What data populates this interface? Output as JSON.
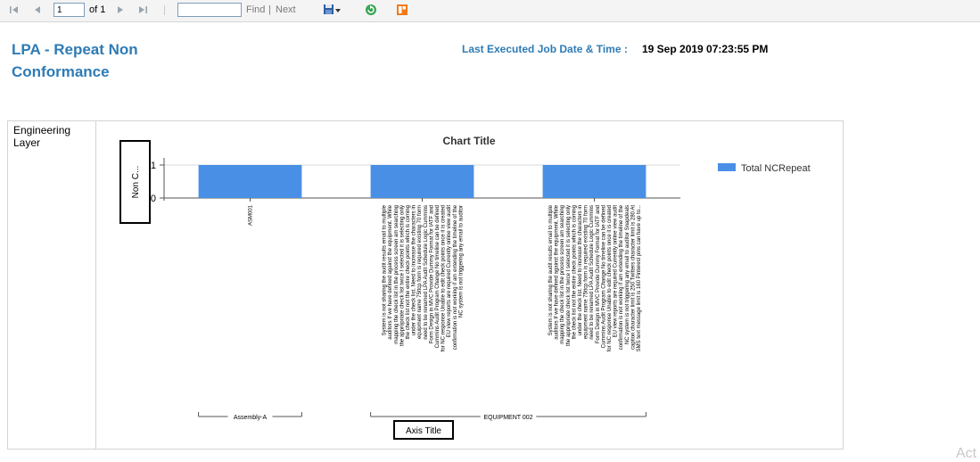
{
  "toolbar": {
    "page_value": "1",
    "page_of": "of 1",
    "search_value": "",
    "find_label": "Find",
    "separator": "|",
    "next_label": "Next"
  },
  "report": {
    "title": "LPA - Repeat Non Conformance",
    "executed_label": "Last Executed Job Date & Time :",
    "executed_value": "19 Sep 2019 07:23:55 PM"
  },
  "row": {
    "header": "Engineering Layer"
  },
  "colors": {
    "bar": "#4a8fe6",
    "title_blue": "#2e7bb5"
  },
  "chart_data": {
    "type": "bar",
    "title": "Chart Title",
    "ylabel": "Non C...",
    "xlabel": "Axis Title",
    "ylim": [
      0,
      1
    ],
    "yticks": [
      "0",
      "1"
    ],
    "categories": [
      "ASM001",
      "System is not sharing the audit results email to multiple auditors If we have defined against the equipment. While mapping the check list in the process screen am searching the appropriate check list twice I selected it is selecting only the check list not the entire check points which is coming under the check list. Need to increase the characters in equipment name 75ttcp form is required existing 70 form need to be renamed LPA Audit Schedule Logic Cummins Form Design in MVC Provide Dummy Format for IATF and Cummins Audit Program Change No timeline can be defined for NC response Unable to edit check points once it is created EU view reports are required Currently online view audit confirmation is not working if am extending the timeline of the NC system is not triggering any email to auditor",
      "System is not sharing the audit results email to multiple auditors If we have defined against the equipment. While mapping the check list in the process screen am searching the appropriate check list twice I selected it is selecting only the check list not the entire check points which is coming under the check list. Need to increase the characters in equipment name 75ttcp form is required existing 70 form need to be renamed LPA Audit Schedule Logic Cummins Form Design in MVC Provide Dummy Format for IATF and Cummins Audit Program Change No timeline can be defined for NC response Unable to edit check points once it is created EU view reports are required Currently online view audit confirmation is not working if am extending the timeline of the NC system is not triggering any email to auditor Snapdeals caption character limit is 250 Twitters character limit is 280 At SMS text message limit is 160 Pinterest pins can have up to..."
    ],
    "category_labels": [
      "ASM001",
      "System is not sharing the audit results email to multiple\nauditors If we have defined against the equipment. While\nmapping the check list in the process screen am searching\nthe appropriate check list twice I selected it is selecting only\nthe check list not the entire check points which is coming\nunder the check list. Need to increase the characters in\nequipment name 75ttcp form is required existing 70 form\nneed to be renamed LPA Audit Schedule Logic Cummins\nForm Design in MVC Provide Dummy Format for IATF and\nCummins Audit Program Change No timeline can be defined\nfor NC response Unable to edit check points once it is created\nEU view reports are required Currently online view audit\nconfirmation is not working if am extending the timeline of the\nNC system is not triggering any email to auditor",
      "System is not sharing the audit results email to multiple\nauditors If we have defined against the equipment. While\nmapping the check list in the process screen am searching\nthe appropriate check list twice I selected it is selecting only\nthe check list not the entire check points which is coming\nunder the check list. Need to increase the characters in\nequipment name 75ttcp form is required existing 70 form\nneed to be renamed LPA Audit Schedule Logic Cummins\nForm Design in MVC Provide Dummy Format for IATF and\nCummins Audit Program Change No timeline can be defined\nfor NC response Unable to edit check points once it is created\nEU view reports are required Currently online view audit\nconfirmation is not working if am extending the timeline of the\nNC system is not triggering any email to auditor Snapdeals\ncaption character limit is 250 Twitters character limit is 280 At\nSMS text message limit is 160 Pinterest pins can have up to..."
    ],
    "groups": [
      {
        "name": "Assembly-A",
        "members": [
          0
        ]
      },
      {
        "name": "EQUIPMENT 002",
        "members": [
          1,
          2
        ]
      }
    ],
    "series": [
      {
        "name": "Total NCRepeat",
        "values": [
          1,
          1,
          1
        ]
      }
    ],
    "legend_position": "right",
    "grid": true
  },
  "watermark": "Act"
}
